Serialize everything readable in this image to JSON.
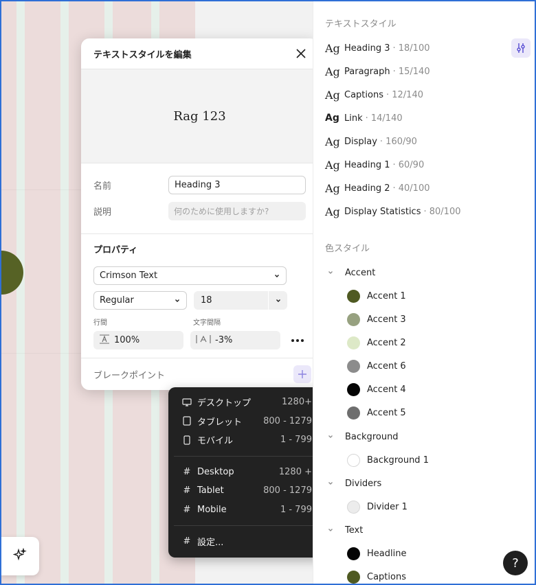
{
  "dialog": {
    "title": "テキストスタイルを編集",
    "preview": "Rag 123",
    "name_label": "名前",
    "name_value": "Heading 3",
    "desc_label": "説明",
    "desc_placeholder": "何のために使用しますか?",
    "properties_title": "プロパティ",
    "font_family": "Crimson Text",
    "font_weight": "Regular",
    "font_size": "18",
    "line_height_label": "行間",
    "line_height_value": "100%",
    "letter_spacing_label": "文字間隔",
    "letter_spacing_value": "-3%",
    "breakpoints_label": "ブレークポイント"
  },
  "menu": {
    "device_items": [
      {
        "label": "デスクトップ",
        "range": "1280+",
        "icon": "monitor-icon"
      },
      {
        "label": "タブレット",
        "range": "800 - 1279",
        "icon": "tablet-icon"
      },
      {
        "label": "モバイル",
        "range": "1 - 799",
        "icon": "mobile-icon"
      }
    ],
    "custom_items": [
      {
        "label": "Desktop",
        "range": "1280 +",
        "icon": "hash-icon"
      },
      {
        "label": "Tablet",
        "range": "800 - 1279",
        "icon": "hash-icon"
      },
      {
        "label": "Mobile",
        "range": "1 - 799",
        "icon": "hash-icon"
      }
    ],
    "settings_label": "設定..."
  },
  "panel": {
    "text_styles_title": "テキストスタイル",
    "text_styles": [
      {
        "ag": "Ag",
        "name": "Heading 3",
        "spec": "· 18/100"
      },
      {
        "ag": "Ag",
        "name": "Paragraph",
        "spec": "· 15/140"
      },
      {
        "ag": "Ag",
        "name": "Captions",
        "spec": "· 12/140"
      },
      {
        "ag": "Ag",
        "name": "Link",
        "spec": "· 14/140"
      },
      {
        "ag": "Ag",
        "name": "Display",
        "spec": "· 160/90"
      },
      {
        "ag": "Ag",
        "name": "Heading 1",
        "spec": "· 60/90"
      },
      {
        "ag": "Ag",
        "name": "Heading 2",
        "spec": "· 40/100"
      },
      {
        "ag": "Ag",
        "name": "Display Statistics",
        "spec": "· 80/100"
      }
    ],
    "color_styles_title": "色スタイル",
    "groups": {
      "accent": {
        "label": "Accent",
        "colors": [
          {
            "name": "Accent 1",
            "hex": "#4f5a22"
          },
          {
            "name": "Accent 3",
            "hex": "#97a180"
          },
          {
            "name": "Accent 2",
            "hex": "#dde9c7"
          },
          {
            "name": "Accent 6",
            "hex": "#8c8c8c"
          },
          {
            "name": "Accent 4",
            "hex": "#050505"
          },
          {
            "name": "Accent 5",
            "hex": "#6e6e6e"
          }
        ]
      },
      "background": {
        "label": "Background",
        "colors": [
          {
            "name": "Background 1",
            "hex": "#ffffff"
          }
        ]
      },
      "dividers": {
        "label": "Dividers",
        "colors": [
          {
            "name": "Divider 1",
            "hex": "#ececec"
          }
        ]
      },
      "text": {
        "label": "Text",
        "colors": [
          {
            "name": "Headline",
            "hex": "#050505"
          },
          {
            "name": "Captions",
            "hex": "#4f5a22"
          }
        ]
      }
    },
    "help_label": "?"
  }
}
